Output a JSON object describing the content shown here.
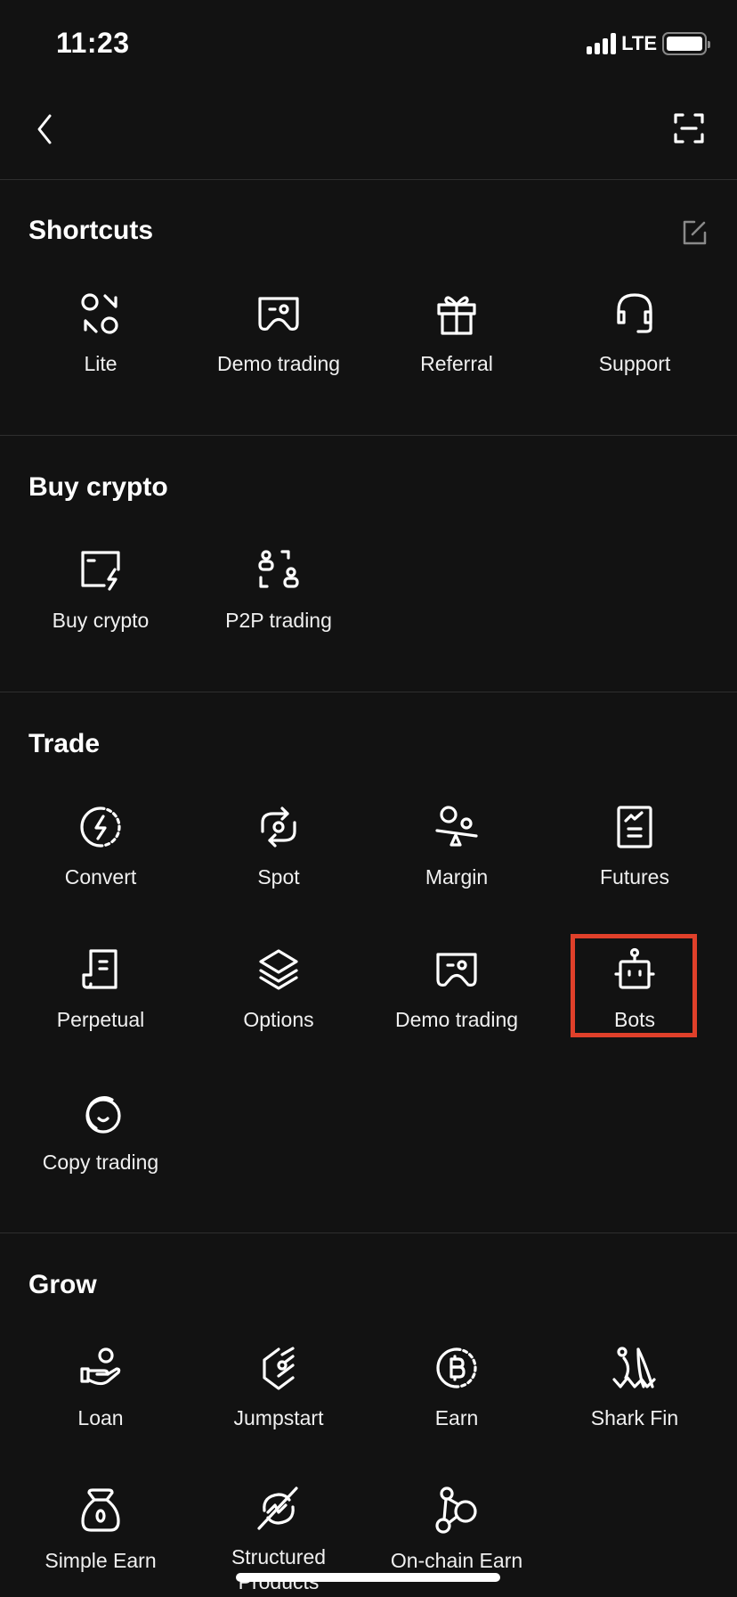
{
  "status_bar": {
    "time": "11:23",
    "network": "LTE",
    "signal_bars": 4,
    "battery_level": 1.0
  },
  "nav": {
    "back_icon": "chevron-left-icon",
    "scan_icon": "scan-icon"
  },
  "accent_colors": {
    "background": "#121212",
    "highlight": "#e0402a",
    "divider": "#2e2e2e"
  },
  "sections": {
    "shortcuts": {
      "title": "Shortcuts",
      "edit_icon": "edit-icon",
      "items": [
        {
          "label": "Lite",
          "icon": "lite-icon"
        },
        {
          "label": "Demo trading",
          "icon": "gamepad-icon"
        },
        {
          "label": "Referral",
          "icon": "gift-icon"
        },
        {
          "label": "Support",
          "icon": "headset-icon"
        }
      ]
    },
    "buy_crypto": {
      "title": "Buy crypto",
      "items": [
        {
          "label": "Buy crypto",
          "icon": "card-lightning-icon"
        },
        {
          "label": "P2P trading",
          "icon": "p2p-icon"
        }
      ]
    },
    "trade": {
      "title": "Trade",
      "items": [
        {
          "label": "Convert",
          "icon": "convert-icon"
        },
        {
          "label": "Spot",
          "icon": "spot-icon"
        },
        {
          "label": "Margin",
          "icon": "margin-icon"
        },
        {
          "label": "Futures",
          "icon": "futures-icon"
        },
        {
          "label": "Perpetual",
          "icon": "perpetual-icon"
        },
        {
          "label": "Options",
          "icon": "layers-icon"
        },
        {
          "label": "Demo trading",
          "icon": "gamepad-icon"
        },
        {
          "label": "Bots",
          "icon": "robot-icon",
          "highlighted": true
        },
        {
          "label": "Copy trading",
          "icon": "copy-trading-icon"
        }
      ]
    },
    "grow": {
      "title": "Grow",
      "items": [
        {
          "label": "Loan",
          "icon": "loan-icon"
        },
        {
          "label": "Jumpstart",
          "icon": "jumpstart-icon"
        },
        {
          "label": "Earn",
          "icon": "bitcoin-earn-icon"
        },
        {
          "label": "Shark Fin",
          "icon": "shark-fin-icon"
        },
        {
          "label": "Simple Earn",
          "icon": "money-bag-icon"
        },
        {
          "label": "Structured Products",
          "icon": "structured-products-icon"
        },
        {
          "label": "On-chain Earn",
          "icon": "on-chain-icon"
        }
      ]
    }
  }
}
